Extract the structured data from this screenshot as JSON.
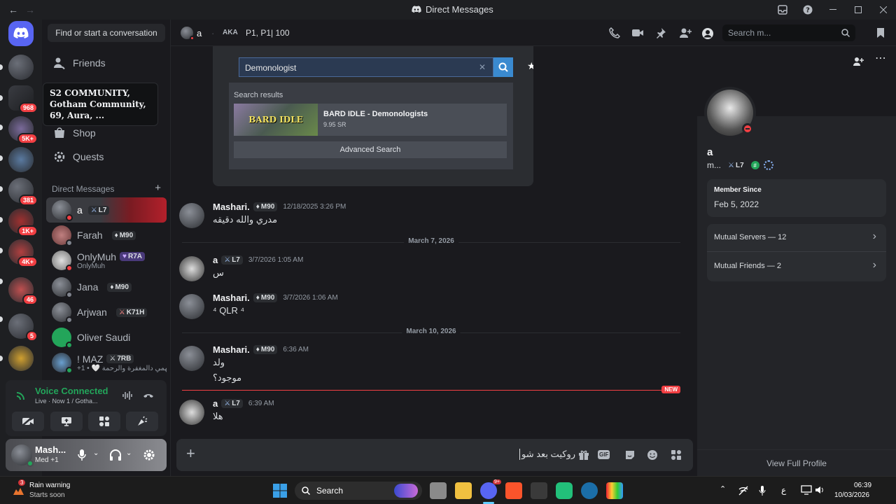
{
  "window": {
    "title": "Direct Messages",
    "back": "←",
    "forward": "→"
  },
  "rail": {
    "servers": [
      {
        "badge": ""
      },
      {
        "badge": "968"
      },
      {
        "badge": "5K+"
      },
      {
        "badge": ""
      },
      {
        "badge": "381"
      },
      {
        "badge": "1K+"
      },
      {
        "badge": "4K+"
      },
      {
        "badge": "46"
      },
      {
        "badge": "5"
      },
      {
        "badge": ""
      }
    ]
  },
  "tooltip": {
    "text": "S2 COMMUNITY, Gotham Community, 69, Aura, ..."
  },
  "sidebar": {
    "search_label": "Find or start a conversation",
    "nav": [
      {
        "label": "Friends"
      },
      {
        "label": "Shop"
      },
      {
        "label": "Quests"
      }
    ],
    "dm_header": "Direct Messages",
    "add": "+",
    "dms": [
      {
        "name": "a",
        "tag": "L7",
        "sub": "",
        "status": "#f23f43"
      },
      {
        "name": "Farah",
        "tag": "M90",
        "sub": "",
        "status": "#80848e"
      },
      {
        "name": "OnlyMuh",
        "tag": "R7A",
        "sub": "OnlyMuh",
        "status": "#f23f43"
      },
      {
        "name": "Jana",
        "tag": "M90",
        "sub": "",
        "status": "#80848e"
      },
      {
        "name": "Arjwan",
        "tag": "K71H",
        "sub": "",
        "status": "#80848e"
      },
      {
        "name": "Oliver Saudi",
        "tag": "",
        "sub": "",
        "status": "#23a55a"
      },
      {
        "name": "! MAZ",
        "tag": "7RB",
        "sub": "+1 • 🤍 اللهمي دالمغفرة والرحمة",
        "status": "#23a55a"
      }
    ]
  },
  "voice": {
    "title": "Voice Connected",
    "sub": "Live · Now 1 / Gotha..."
  },
  "user": {
    "name": "Mash...",
    "status": "Med +1"
  },
  "header": {
    "name": "a",
    "aka_label": "AKA",
    "aka": "P1, P1| 100",
    "search_placeholder": "Search m..."
  },
  "embed": {
    "query": "Demonologist",
    "results_label": "Search results",
    "result_title": "BARD IDLE - Demonologists",
    "result_price": "9.95 SR",
    "thumb_text": "BARD IDLE",
    "advanced": "Advanced Search"
  },
  "messages": [
    {
      "user": "Mashari.",
      "tag": "M90",
      "time": "12/18/2025 3:26 PM",
      "lines": [
        "مدري والله دقيقه"
      ]
    },
    {
      "divider": "March 7, 2026"
    },
    {
      "user": "a",
      "tag": "L7",
      "time": "3/7/2026 1:05 AM",
      "lines": [
        "س"
      ]
    },
    {
      "user": "Mashari.",
      "tag": "M90",
      "time": "3/7/2026 1:06 AM",
      "lines": [
        "⁴ QLR ⁴"
      ]
    },
    {
      "divider": "March 10, 2026"
    },
    {
      "user": "Mashari.",
      "tag": "M90",
      "time": "6:36 AM",
      "lines": [
        "ولد",
        "موجود؟"
      ]
    },
    {
      "new": "NEW"
    },
    {
      "user": "a",
      "tag": "L7",
      "time": "6:39 AM",
      "lines": [
        "هلا"
      ]
    }
  ],
  "composer": {
    "value": "روكيت بعد شو",
    "gif": "GIF"
  },
  "profile": {
    "name": "a",
    "handle": "m...",
    "tag": "L7",
    "member_since_label": "Member Since",
    "member_since": "Feb 5, 2022",
    "mutual_servers": "Mutual Servers — 12",
    "mutual_friends": "Mutual Friends — 2",
    "view_full": "View Full Profile"
  },
  "taskbar": {
    "weather_title": "Rain warning",
    "weather_sub": "Starts soon",
    "weather_badge": "3",
    "search": "Search",
    "discord_badge": "9+",
    "lang": "ع",
    "time": "06:39",
    "date": "10/03/2026"
  },
  "colors": {
    "accent": "#5865f2",
    "online": "#23a55a",
    "dnd": "#f23f43",
    "new": "#f23f43"
  }
}
